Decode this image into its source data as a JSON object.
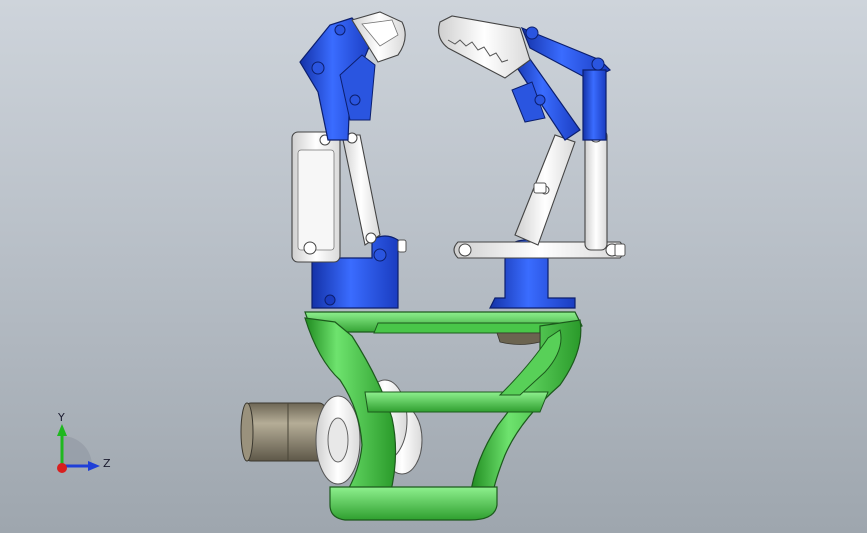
{
  "viewport": {
    "background_top": "#ced4db",
    "background_bottom": "#9ea6ae"
  },
  "model": {
    "colors": {
      "frame_green": "#3db83d",
      "linkage_blue": "#2050d8",
      "linkage_white": "#f4f4f4",
      "motor_gray": "#8c8471"
    }
  },
  "triad": {
    "y_label": "Y",
    "z_label": "Z",
    "colors": {
      "y": "#1fb81f",
      "z": "#1f3fd8",
      "x": "#d81f1f"
    }
  }
}
